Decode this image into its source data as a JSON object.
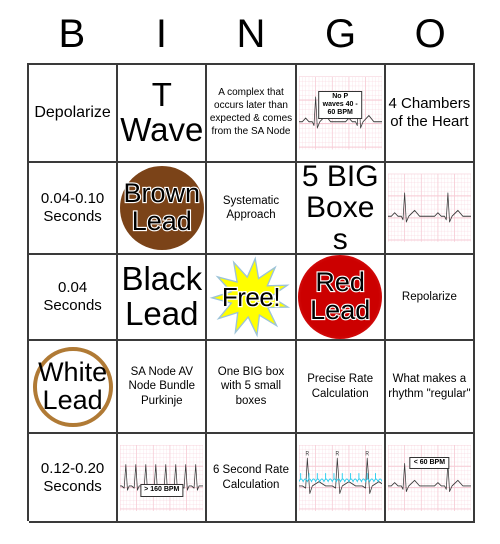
{
  "header": {
    "letters": [
      "B",
      "I",
      "N",
      "G",
      "O"
    ]
  },
  "grid": {
    "rows": [
      [
        {
          "kind": "text",
          "name": "cell-b1",
          "text": "Depolarize",
          "size": "t-reg"
        },
        {
          "kind": "text",
          "name": "cell-i1",
          "text": "T Wave",
          "size": "t-xl"
        },
        {
          "kind": "text",
          "name": "cell-n1",
          "text": "A complex that occurs later than expected & comes from the SA Node",
          "size": "t-xs"
        },
        {
          "kind": "ecg",
          "name": "cell-g1",
          "label": "No P waves 40 - 60 BPM",
          "variant": "label-box"
        },
        {
          "kind": "text",
          "name": "cell-o1",
          "text": "4 Chambers of the Heart",
          "size": "t-med"
        }
      ],
      [
        {
          "kind": "text",
          "name": "cell-b2",
          "text": "0.04-0.10 Seconds",
          "size": "t-med"
        },
        {
          "kind": "token",
          "name": "cell-i2",
          "text": "Brown Lead",
          "style": "brown",
          "color": "#7b4318"
        },
        {
          "kind": "text",
          "name": "cell-n2",
          "text": "Systematic Approach",
          "size": "t-sm"
        },
        {
          "kind": "text",
          "name": "cell-g2",
          "text": "5 BIG Boxes",
          "size": "t-lg"
        },
        {
          "kind": "ecg",
          "name": "cell-o2",
          "label": "",
          "variant": "plain"
        }
      ],
      [
        {
          "kind": "text",
          "name": "cell-b3",
          "text": "0.04 Seconds",
          "size": "t-med"
        },
        {
          "kind": "text",
          "name": "cell-i3",
          "text": "Black Lead",
          "size": "t-xl"
        },
        {
          "kind": "free",
          "name": "cell-n3",
          "text": "Free!",
          "color": "#ffff00"
        },
        {
          "kind": "token",
          "name": "cell-g3",
          "text": "Red Lead",
          "style": "red",
          "color": "#cc0000"
        },
        {
          "kind": "text",
          "name": "cell-o3",
          "text": "Repolarize",
          "size": "t-sm"
        }
      ],
      [
        {
          "kind": "ring",
          "name": "cell-b4",
          "text": "White Lead",
          "color": "#b07a35"
        },
        {
          "kind": "text",
          "name": "cell-i4",
          "text": "SA Node AV Node Bundle Purkinje",
          "size": "t-sm"
        },
        {
          "kind": "text",
          "name": "cell-n4",
          "text": "One BIG box with 5 small boxes",
          "size": "t-sm"
        },
        {
          "kind": "text",
          "name": "cell-g4",
          "text": "Precise Rate Calculation",
          "size": "t-sm"
        },
        {
          "kind": "text",
          "name": "cell-o4",
          "text": "What makes a rhythm \"regular\"",
          "size": "t-sm"
        }
      ],
      [
        {
          "kind": "text",
          "name": "cell-b5",
          "text": "0.12-0.20 Seconds",
          "size": "t-med"
        },
        {
          "kind": "ecg",
          "name": "cell-i5",
          "label": "> 160 BPM",
          "variant": "fast"
        },
        {
          "kind": "text",
          "name": "cell-n5",
          "text": "6 Second Rate Calculation",
          "size": "t-sm"
        },
        {
          "kind": "ecg",
          "name": "cell-g5",
          "label": "",
          "variant": "annotated"
        },
        {
          "kind": "ecg",
          "name": "cell-o5",
          "label": "< 60 BPM",
          "variant": "slow"
        }
      ]
    ]
  },
  "colors": {
    "border": "#3a3a3a",
    "ecg_grid": "#f6c9d4",
    "ecg_trace": "#3a3a3a",
    "annotation": "#22ccee",
    "brown_lead": "#7b4318",
    "red_lead": "#cc0000",
    "white_lead_ring": "#b07a35",
    "free_star": "#ffff00"
  }
}
